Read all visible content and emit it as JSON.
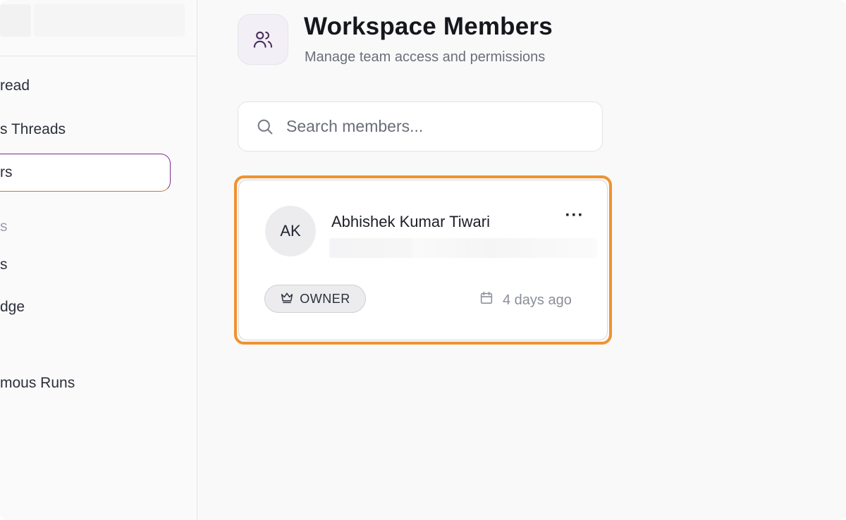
{
  "sidebar": {
    "items": [
      {
        "label": "read",
        "active": false
      },
      {
        "label": "s Threads",
        "active": false
      },
      {
        "label": "rs",
        "active": true
      },
      {
        "label": "s",
        "active": false
      },
      {
        "label": "s",
        "active": false
      },
      {
        "label": "dge",
        "active": false
      },
      {
        "label": "mous Runs",
        "active": false
      }
    ]
  },
  "header": {
    "title": "Workspace Members",
    "subtitle": "Manage team access and permissions",
    "icon": "users-icon"
  },
  "search": {
    "placeholder": "Search members...",
    "value": ""
  },
  "members": [
    {
      "initials": "AK",
      "name": "Abhishek Kumar Tiwari",
      "role": "OWNER",
      "joined": "4 days ago"
    }
  ],
  "colors": {
    "highlight": "#f0922e",
    "active_nav_border": "#7b2d8e"
  }
}
